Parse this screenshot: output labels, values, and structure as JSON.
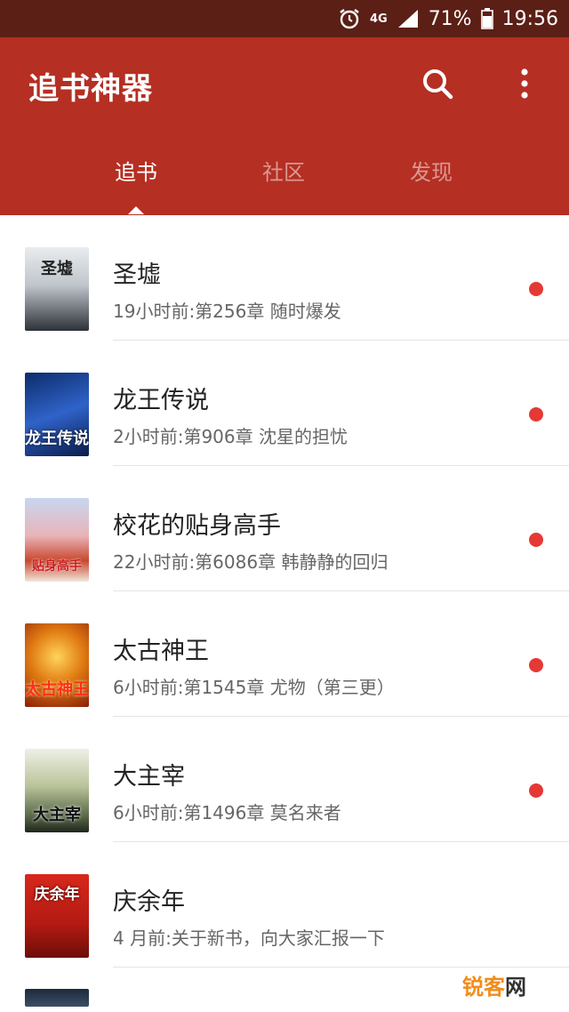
{
  "status": {
    "battery": "71%",
    "time": "19:56",
    "network": "4G"
  },
  "header": {
    "title": "追书神器"
  },
  "tabs": [
    {
      "label": "追书"
    },
    {
      "label": "社区"
    },
    {
      "label": "发现"
    }
  ],
  "books": [
    {
      "title": "圣墟",
      "update": "19小时前:第256章 随时爆发",
      "cover_text": "圣墟"
    },
    {
      "title": "龙王传说",
      "update": "2小时前:第906章 沈星的担忧",
      "cover_text": "龙王传说"
    },
    {
      "title": "校花的贴身高手",
      "update": "22小时前:第6086章 韩静静的回归",
      "cover_text": "贴身高手"
    },
    {
      "title": "太古神王",
      "update": "6小时前:第1545章 尤物（第三更）",
      "cover_text": "太古神王"
    },
    {
      "title": "大主宰",
      "update": "6小时前:第1496章 莫名来者",
      "cover_text": "大主宰"
    },
    {
      "title": "庆余年",
      "update": "4 月前:关于新书，向大家汇报一下",
      "cover_text": "庆余年"
    }
  ],
  "watermark": {
    "brand": "锐客",
    "suffix": "网"
  },
  "colors": {
    "primary": "#b52f23",
    "status_bar": "#5b1f16",
    "unread_dot": "#e53935"
  }
}
